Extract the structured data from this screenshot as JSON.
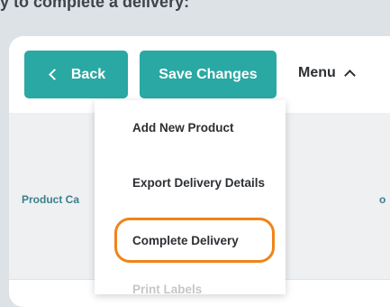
{
  "top_text": "y to complete a delivery:",
  "toolbar": {
    "back_label": "Back",
    "save_label": "Save Changes",
    "menu_label": "Menu"
  },
  "table": {
    "columns": [
      "Product Ca",
      "o"
    ]
  },
  "menu": {
    "items": [
      "Add New Product",
      "Export Delivery Details",
      "Complete Delivery",
      "Print Labels"
    ]
  },
  "colors": {
    "button_bg": "#2aa8a3",
    "highlight": "#f08418",
    "column_label": "#3d7f8c"
  }
}
